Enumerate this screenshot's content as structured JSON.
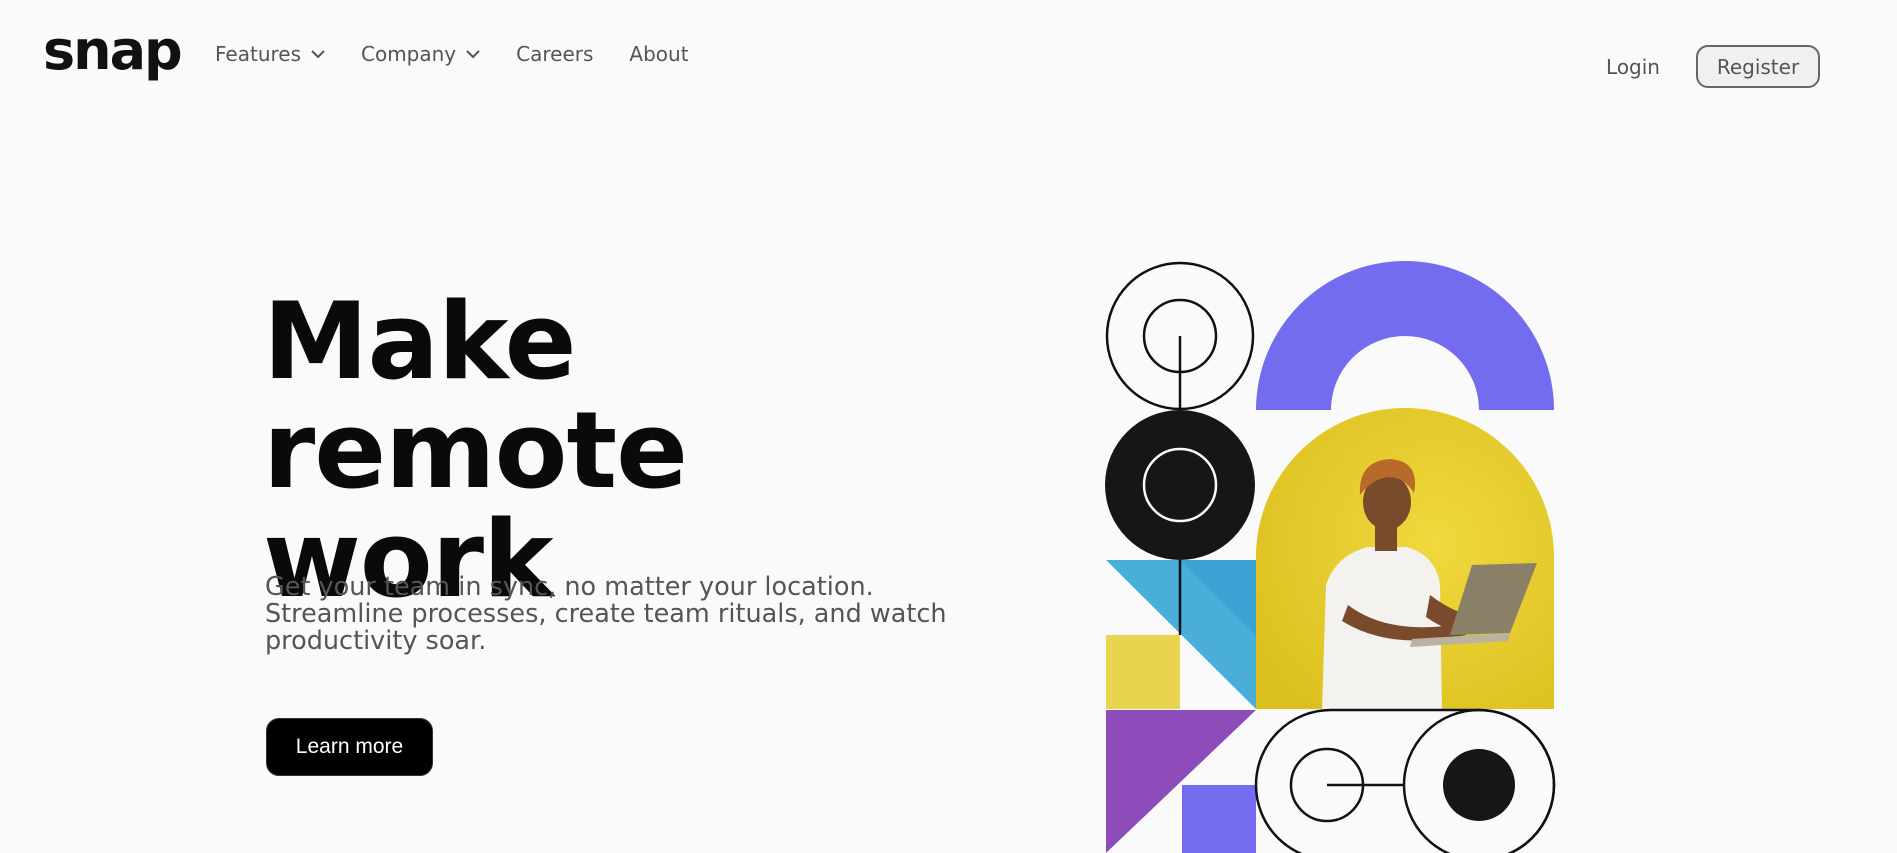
{
  "brand": {
    "logo": "snap"
  },
  "nav": {
    "features": "Features",
    "company": "Company",
    "careers": "Careers",
    "about": "About"
  },
  "auth": {
    "login": "Login",
    "register": "Register"
  },
  "hero": {
    "title_line1": "Make remote",
    "title_line2": "work",
    "subtitle": "Get your team in sync, no matter your location. Streamline processes, create team rituals, and watch productivity soar.",
    "cta": "Learn more"
  },
  "icons": {
    "features_dropdown": "chevron-down-icon",
    "company_dropdown": "chevron-down-icon"
  },
  "colors": {
    "background": "#fafafa",
    "text": "#111111",
    "muted": "#555555",
    "purple": "#726cee",
    "yellow": "#e8d23a",
    "blue": "#4aaedb",
    "violet": "#8e4cbb"
  }
}
